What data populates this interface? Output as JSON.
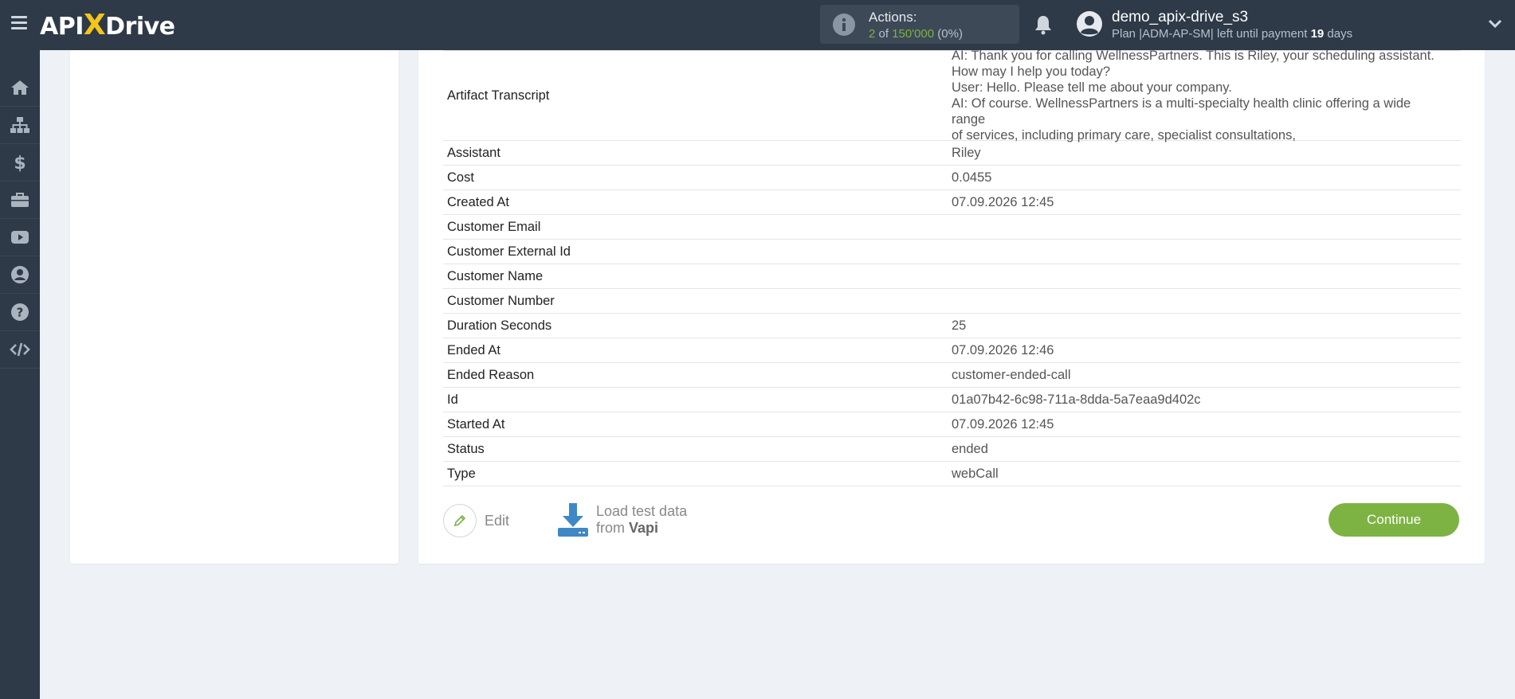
{
  "header": {
    "logo_left": "API",
    "logo_x": "X",
    "logo_right": "Drive",
    "actions_label": "Actions:",
    "actions_used": "2",
    "actions_of": "of",
    "actions_total": "150'000",
    "actions_pct": "(0%)",
    "username": "demo_apix-drive_s3",
    "plan_text": "Plan |ADM-AP-SM| left until payment",
    "plan_days": "19",
    "plan_days_unit": "days"
  },
  "sidebar": {
    "items": [
      {
        "name": "home-icon"
      },
      {
        "name": "sitemap-icon"
      },
      {
        "name": "dollar-icon"
      },
      {
        "name": "briefcase-icon"
      },
      {
        "name": "youtube-icon"
      },
      {
        "name": "user-circle-icon"
      },
      {
        "name": "question-icon"
      },
      {
        "name": "code-icon"
      }
    ]
  },
  "table": {
    "rows": [
      {
        "key": "Artifact Transcript",
        "lines": [
          "AI: Thank you for calling WellnessPartners. This is Riley, your scheduling assistant.",
          "How may I help you today?",
          "User: Hello. Please tell me about your company.",
          "AI: Of course. WellnessPartners is a multi-specialty health clinic offering a wide range",
          "of services, including primary care, specialist consultations,"
        ]
      },
      {
        "key": "Assistant",
        "value": "Riley"
      },
      {
        "key": "Cost",
        "value": "0.0455"
      },
      {
        "key": "Created At",
        "value": "07.09.2026 12:45"
      },
      {
        "key": "Customer Email",
        "value": ""
      },
      {
        "key": "Customer External Id",
        "value": ""
      },
      {
        "key": "Customer Name",
        "value": ""
      },
      {
        "key": "Customer Number",
        "value": ""
      },
      {
        "key": "Duration Seconds",
        "value": "25"
      },
      {
        "key": "Ended At",
        "value": "07.09.2026 12:46"
      },
      {
        "key": "Ended Reason",
        "value": "customer-ended-call"
      },
      {
        "key": "Id",
        "value": "01a07b42-6c98-711a-8dda-5a7eaa9d402c"
      },
      {
        "key": "Started At",
        "value": "07.09.2026 12:45"
      },
      {
        "key": "Status",
        "value": "ended"
      },
      {
        "key": "Type",
        "value": "webCall"
      }
    ]
  },
  "buttons": {
    "edit": "Edit",
    "load_line1": "Load test data",
    "load_from": "from",
    "load_source": "Vapi",
    "continue": "Continue"
  },
  "colors": {
    "topbar": "#2e3a48",
    "accent_green": "#7cb342",
    "logo_x": "#f5c518",
    "download_blue": "#3f88c5"
  }
}
